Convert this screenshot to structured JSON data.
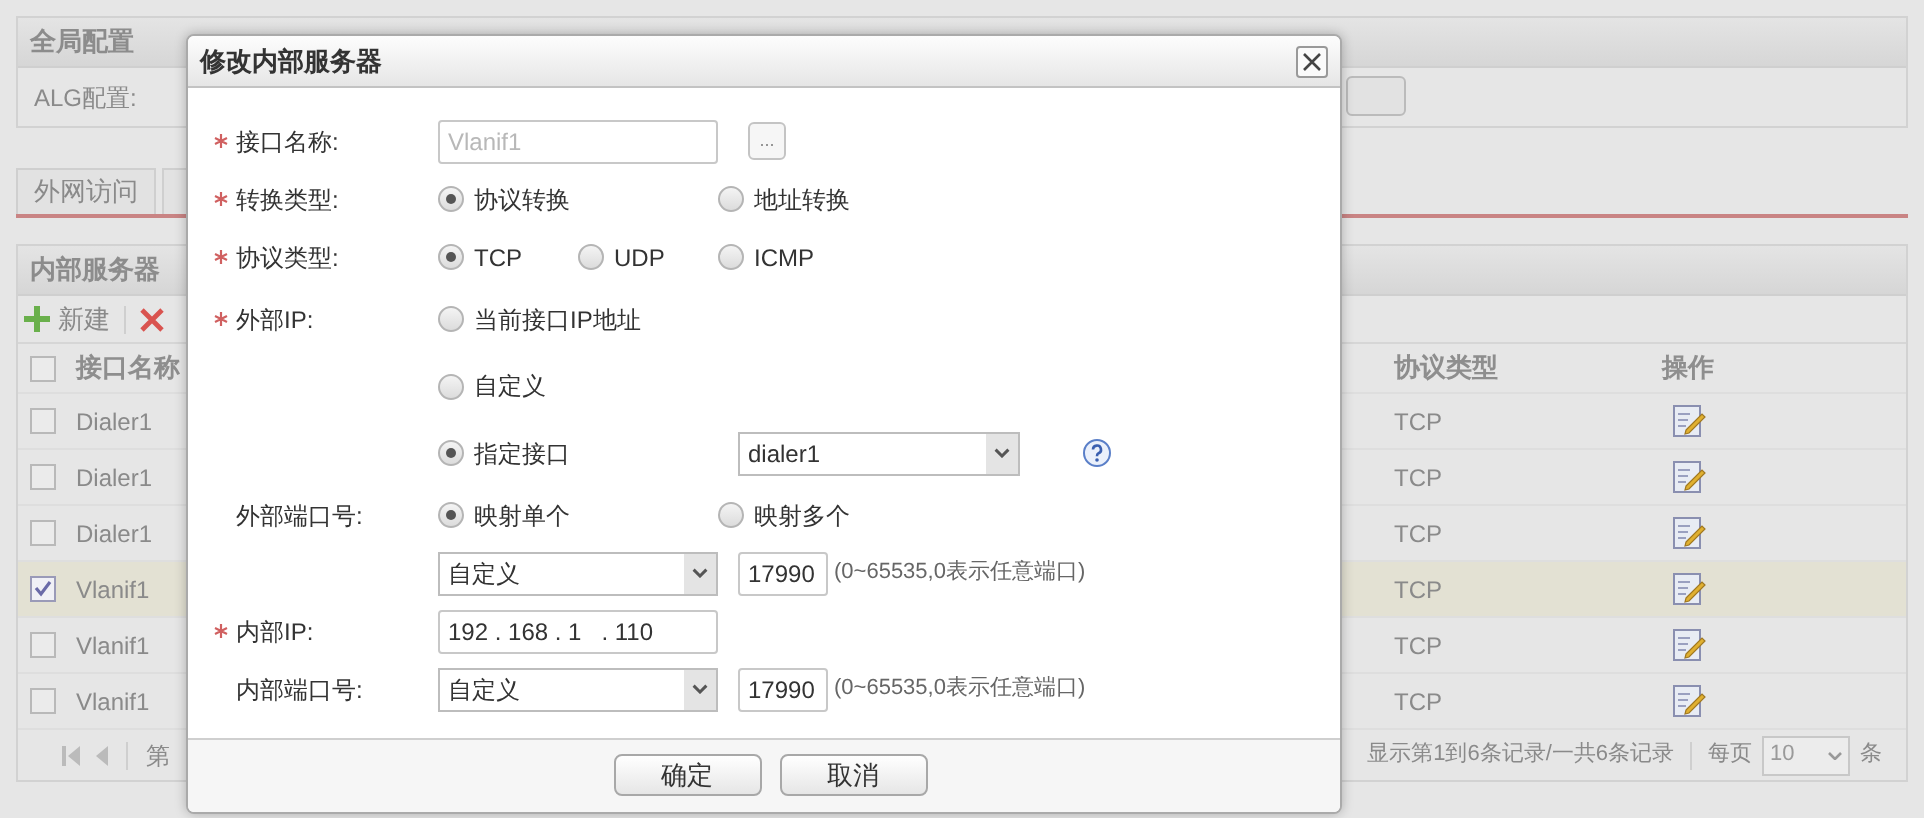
{
  "global_panel": {
    "title": "全局配置",
    "alg_label": "ALG配置:"
  },
  "tabs": [
    {
      "label": "外网访问"
    }
  ],
  "server_panel": {
    "title": "内部服务器",
    "toolbar": [
      {
        "kind": "add",
        "label": "新建"
      },
      {
        "kind": "delete"
      }
    ],
    "table": {
      "all_selected": false,
      "columns": [
        "接口名称",
        "协议类型",
        "操作"
      ],
      "rows": [
        {
          "interface": "Dialer1",
          "protocol": "TCP",
          "selected": false
        },
        {
          "interface": "Dialer1",
          "protocol": "TCP",
          "selected": false
        },
        {
          "interface": "Dialer1",
          "protocol": "TCP",
          "selected": false
        },
        {
          "interface": "Vlanif1",
          "protocol": "TCP",
          "selected": true
        },
        {
          "interface": "Vlanif1",
          "protocol": "TCP",
          "selected": false
        },
        {
          "interface": "Vlanif1",
          "protocol": "TCP",
          "selected": false
        }
      ]
    },
    "pagination": {
      "page_label": "第",
      "summary": "显示第1到6条记录/一共6条记录",
      "per_page_label": "每页",
      "per_page": "10",
      "unit": "条"
    }
  },
  "dialog": {
    "title": "修改内部服务器",
    "rows": [
      {
        "kind": "text",
        "label": "接口名称:",
        "required": true,
        "value": "Vlanif1",
        "disabled": true,
        "browse": "..."
      },
      {
        "kind": "radios",
        "label": "转换类型:",
        "required": true,
        "options": [
          {
            "label": "协议转换",
            "selected": true
          },
          {
            "label": "地址转换",
            "selected": false
          }
        ]
      },
      {
        "kind": "radios",
        "label": "协议类型:",
        "required": true,
        "options": [
          {
            "label": "TCP",
            "selected": true
          },
          {
            "label": "UDP",
            "selected": false
          },
          {
            "label": "ICMP",
            "selected": false
          }
        ]
      },
      {
        "kind": "radios",
        "label": "外部IP:",
        "required": true,
        "options": [
          {
            "label": "当前接口IP地址",
            "selected": false
          }
        ]
      },
      {
        "kind": "radios",
        "options": [
          {
            "label": "自定义",
            "selected": false
          }
        ]
      },
      {
        "kind": "radio-select",
        "options": [
          {
            "label": "指定接口",
            "selected": true
          }
        ],
        "select": "dialer1"
      },
      {
        "kind": "radios",
        "label": "外部端口号:",
        "required": false,
        "options": [
          {
            "label": "映射单个",
            "selected": true
          },
          {
            "label": "映射多个",
            "selected": false
          }
        ]
      },
      {
        "kind": "port",
        "select": "自定义",
        "value": "17990",
        "hint": "(0~65535,0表示任意端口)"
      },
      {
        "kind": "ip",
        "label": "内部IP:",
        "required": true,
        "value": "192 . 168 . 1   . 110"
      },
      {
        "kind": "port",
        "label": "内部端口号:",
        "required": false,
        "select": "自定义",
        "value": "17990",
        "hint": "(0~65535,0表示任意端口)"
      }
    ],
    "buttons": [
      "确定",
      "取消"
    ]
  }
}
